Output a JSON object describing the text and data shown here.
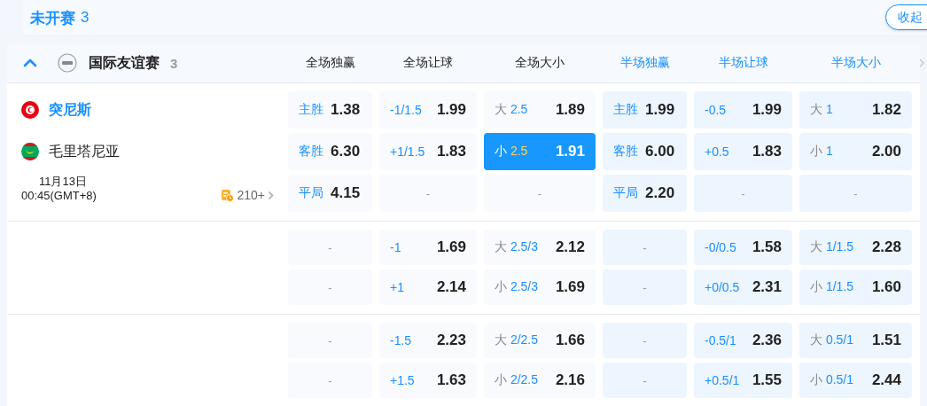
{
  "section": {
    "title": "未开赛",
    "count": "3",
    "collapse_button": "收起"
  },
  "league": {
    "expanded": true,
    "name": "国际友谊赛",
    "count": "3"
  },
  "columns": [
    {
      "label": "全场独赢",
      "kind": "full"
    },
    {
      "label": "全场让球",
      "kind": "full"
    },
    {
      "label": "全场大小",
      "kind": "full"
    },
    {
      "label": "半场独赢",
      "kind": "half"
    },
    {
      "label": "半场让球",
      "kind": "half"
    },
    {
      "label": "半场大小",
      "kind": "half"
    }
  ],
  "groups": [
    {
      "match": {
        "home": "突尼斯",
        "away": "毛里塔尼亚",
        "date": "11月13日",
        "time": "00:45(GMT+8)",
        "more": "210+"
      },
      "rows": [
        [
          {
            "kind": "result",
            "label": "主胜",
            "odds": "1.38",
            "selected": false
          },
          {
            "kind": "handicap",
            "line": "-1/1.5",
            "odds": "1.99",
            "selected": false
          },
          {
            "kind": "total",
            "label": "大",
            "line": "2.5",
            "odds": "1.89",
            "selected": false
          },
          {
            "kind": "result",
            "label": "主胜",
            "odds": "1.99",
            "selected": false
          },
          {
            "kind": "handicap",
            "line": "-0.5",
            "odds": "1.99",
            "selected": false
          },
          {
            "kind": "total",
            "label": "大",
            "line": "1",
            "odds": "1.82",
            "selected": false
          }
        ],
        [
          {
            "kind": "result",
            "label": "客胜",
            "odds": "6.30",
            "selected": false
          },
          {
            "kind": "handicap",
            "line": "+1/1.5",
            "odds": "1.83",
            "selected": false
          },
          {
            "kind": "total",
            "label": "小",
            "line": "2.5",
            "odds": "1.91",
            "selected": true
          },
          {
            "kind": "result",
            "label": "客胜",
            "odds": "6.00",
            "selected": false
          },
          {
            "kind": "handicap",
            "line": "+0.5",
            "odds": "1.83",
            "selected": false
          },
          {
            "kind": "total",
            "label": "小",
            "line": "1",
            "odds": "2.00",
            "selected": false
          }
        ],
        [
          {
            "kind": "result",
            "label": "平局",
            "odds": "4.15",
            "selected": false
          },
          {
            "kind": "empty",
            "text": "-",
            "selected": false
          },
          {
            "kind": "empty",
            "text": "-",
            "selected": false
          },
          {
            "kind": "result",
            "label": "平局",
            "odds": "2.20",
            "selected": false
          },
          {
            "kind": "empty",
            "text": "-",
            "selected": false
          },
          {
            "kind": "empty",
            "text": "-",
            "selected": false
          }
        ]
      ]
    },
    {
      "rows": [
        [
          {
            "kind": "empty",
            "text": "-",
            "selected": false
          },
          {
            "kind": "handicap",
            "line": "-1",
            "odds": "1.69",
            "selected": false
          },
          {
            "kind": "total",
            "label": "大",
            "line": "2.5/3",
            "odds": "2.12",
            "selected": false
          },
          {
            "kind": "empty",
            "text": "-",
            "selected": false
          },
          {
            "kind": "handicap",
            "line": "-0/0.5",
            "odds": "1.58",
            "selected": false
          },
          {
            "kind": "total",
            "label": "大",
            "line": "1/1.5",
            "odds": "2.28",
            "selected": false
          }
        ],
        [
          {
            "kind": "empty",
            "text": "-",
            "selected": false
          },
          {
            "kind": "handicap",
            "line": "+1",
            "odds": "2.14",
            "selected": false
          },
          {
            "kind": "total",
            "label": "小",
            "line": "2.5/3",
            "odds": "1.69",
            "selected": false
          },
          {
            "kind": "empty",
            "text": "-",
            "selected": false
          },
          {
            "kind": "handicap",
            "line": "+0/0.5",
            "odds": "2.31",
            "selected": false
          },
          {
            "kind": "total",
            "label": "小",
            "line": "1/1.5",
            "odds": "1.60",
            "selected": false
          }
        ]
      ]
    },
    {
      "rows": [
        [
          {
            "kind": "empty",
            "text": "-",
            "selected": false
          },
          {
            "kind": "handicap",
            "line": "-1.5",
            "odds": "2.23",
            "selected": false
          },
          {
            "kind": "total",
            "label": "大",
            "line": "2/2.5",
            "odds": "1.66",
            "selected": false
          },
          {
            "kind": "empty",
            "text": "-",
            "selected": false
          },
          {
            "kind": "handicap",
            "line": "-0.5/1",
            "odds": "2.36",
            "selected": false
          },
          {
            "kind": "total",
            "label": "大",
            "line": "0.5/1",
            "odds": "1.51",
            "selected": false
          }
        ],
        [
          {
            "kind": "empty",
            "text": "-",
            "selected": false
          },
          {
            "kind": "handicap",
            "line": "+1.5",
            "odds": "1.63",
            "selected": false
          },
          {
            "kind": "total",
            "label": "小",
            "line": "2/2.5",
            "odds": "2.16",
            "selected": false
          },
          {
            "kind": "empty",
            "text": "-",
            "selected": false
          },
          {
            "kind": "handicap",
            "line": "+0.5/1",
            "odds": "1.55",
            "selected": false
          },
          {
            "kind": "total",
            "label": "小",
            "line": "0.5/1",
            "odds": "2.44",
            "selected": false
          }
        ]
      ]
    }
  ]
}
